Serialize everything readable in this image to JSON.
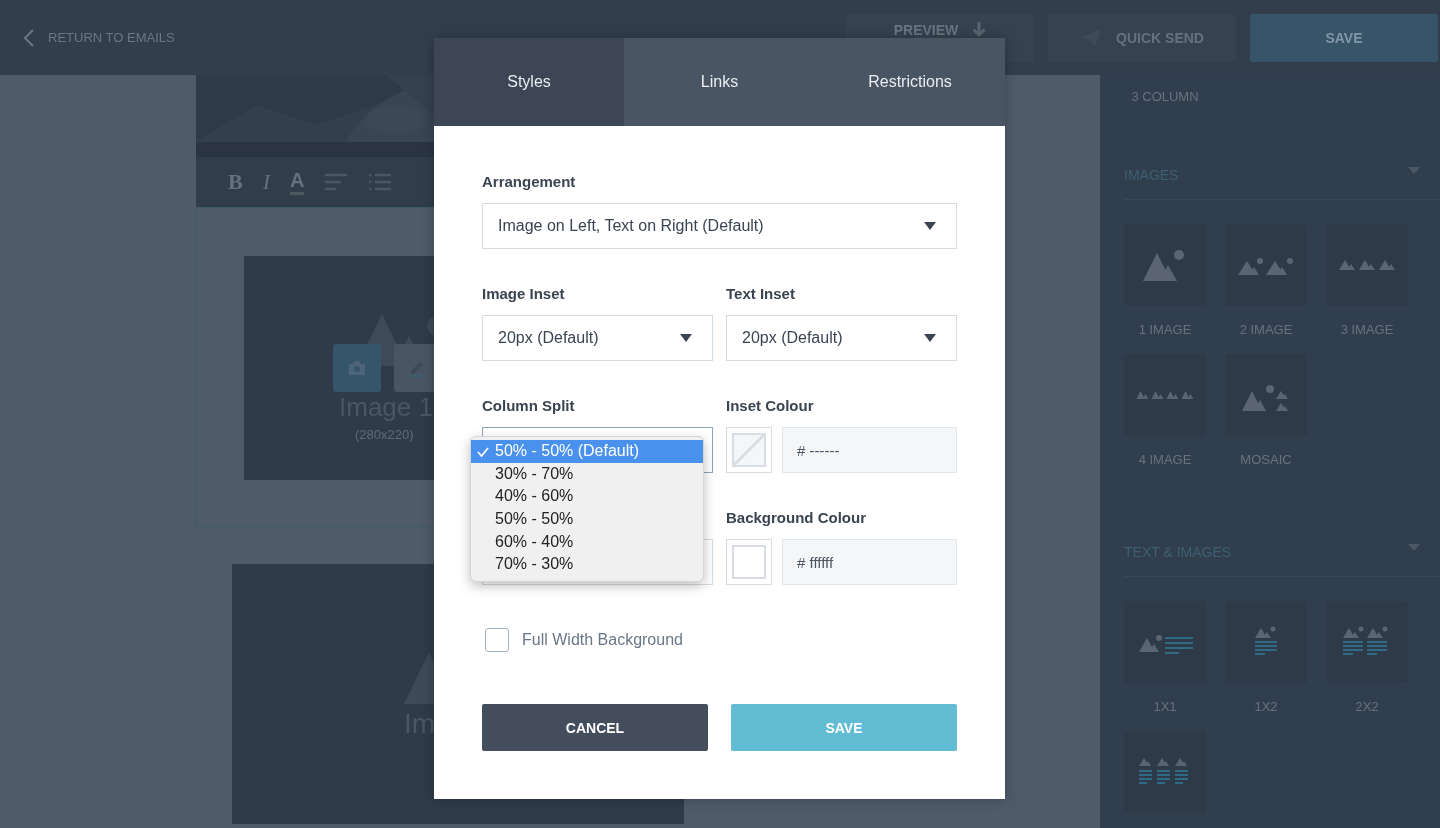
{
  "topbar": {
    "back_link": "RETURN TO EMAILS",
    "buttons": [
      {
        "label": "PREVIEW",
        "kind": "preview"
      },
      {
        "label": "QUICK SEND",
        "kind": "send"
      },
      {
        "label": "SAVE",
        "kind": "primary"
      }
    ]
  },
  "editor": {
    "toolbar": [
      {
        "label": "B",
        "kind": "bold"
      },
      {
        "label": "I",
        "kind": "italic"
      },
      {
        "label": "A",
        "kind": "color"
      }
    ],
    "blocks": [
      {
        "title": "Image 1",
        "size": "(280x220)",
        "kind": "selected"
      },
      {
        "title": "Im",
        "kind": "plain"
      }
    ]
  },
  "sidebar": {
    "top_label": "3 COLUMN",
    "sections": [
      {
        "title": "IMAGES",
        "items": [
          {
            "label": "1 IMAGE",
            "kind": "img1"
          },
          {
            "label": "2 IMAGE",
            "kind": "img2"
          },
          {
            "label": "3 IMAGE",
            "kind": "img3"
          },
          {
            "label": "4 IMAGE",
            "kind": "img4"
          },
          {
            "label": "MOSAIC",
            "kind": "mosaic"
          }
        ]
      },
      {
        "title": "TEXT & IMAGES",
        "items": [
          {
            "label": "1X1",
            "kind": "t1x1"
          },
          {
            "label": "1X2",
            "kind": "t1x2"
          },
          {
            "label": "2X2",
            "kind": "t2x2"
          },
          {
            "kind": "t3"
          }
        ]
      }
    ]
  },
  "modal": {
    "tabs": [
      {
        "label": "Styles",
        "selected": true
      },
      {
        "label": "Links",
        "selected": false
      },
      {
        "label": "Restrictions",
        "selected": false
      }
    ],
    "arrangement": {
      "label": "Arrangement",
      "value": "Image on Left, Text on Right (Default)"
    },
    "insets": [
      {
        "label": "Image Inset",
        "value": "20px (Default)"
      },
      {
        "label": "Text Inset",
        "value": "20px (Default)"
      }
    ],
    "column_split": {
      "label": "Column Split",
      "options": [
        {
          "label": "50% - 50% (Default)",
          "selected": true
        },
        {
          "label": "30% - 70%",
          "selected": false
        },
        {
          "label": "40% - 60%",
          "selected": false
        },
        {
          "label": "50% - 50%",
          "selected": false
        },
        {
          "label": "60% - 40%",
          "selected": false
        },
        {
          "label": "70% - 30%",
          "selected": false
        }
      ]
    },
    "colours": [
      {
        "label": "Inset Colour",
        "value": "# ------",
        "kind": "none"
      },
      {
        "label": "Background Colour",
        "value": "# ffffff",
        "kind": "solid"
      }
    ],
    "full_width": {
      "label": "Full Width Background",
      "checked": false
    },
    "buttons": [
      {
        "label": "CANCEL",
        "kind": "secondary"
      },
      {
        "label": "SAVE",
        "kind": "primary"
      }
    ]
  }
}
